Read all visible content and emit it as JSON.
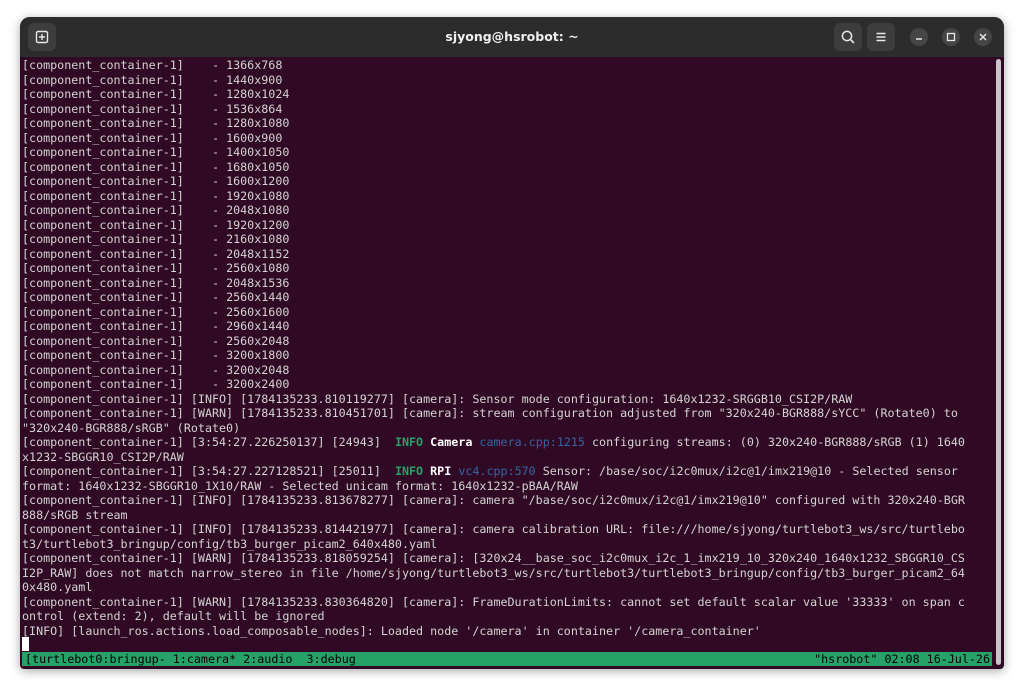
{
  "window": {
    "title": "sjyong@hsrobot: ~"
  },
  "icons": {
    "new_tab": "new-tab-icon",
    "search": "search-icon",
    "menu": "hamburger-menu-icon",
    "minimize": "minimize-icon",
    "maximize": "maximize-icon",
    "close": "close-icon"
  },
  "terminal": {
    "resolution_prefix": "[component_container-1]    - ",
    "resolutions": [
      "1366x768",
      "1440x900",
      "1280x1024",
      "1536x864",
      "1280x1080",
      "1600x900",
      "1400x1050",
      "1680x1050",
      "1600x1200",
      "1920x1080",
      "2048x1080",
      "1920x1200",
      "2160x1080",
      "2048x1152",
      "2560x1080",
      "2048x1536",
      "2560x1440",
      "2560x1600",
      "2960x1440",
      "2560x2048",
      "3200x1800",
      "3200x2048",
      "3200x2400"
    ],
    "log": {
      "l1": "[component_container-1] [INFO] [1784135233.810119277] [camera]: Sensor mode configuration: 1640x1232-SRGGB10_CSI2P/RAW",
      "l2": "[component_container-1] [WARN] [1784135233.810451701] [camera]: stream configuration adjusted from \"320x240-BGR888/sYCC\" (Rotate0) to",
      "l3": "\"320x240-BGR888/sRGB\" (Rotate0)",
      "l4_pre": "[component_container-1] [3:54:27.226250137] [24943]  ",
      "l4_level": "INFO",
      "l4_cat": "Camera",
      "l4_src": "camera.cpp:1215",
      "l4_msg": " configuring streams: (0) 320x240-BGR888/sRGB (1) 1640",
      "l5": "x1232-SBGGR10_CSI2P/RAW",
      "l6_pre": "[component_container-1] [3:54:27.227128521] [25011]  ",
      "l6_level": "INFO",
      "l6_cat": "RPI",
      "l6_src": "vc4.cpp:570",
      "l6_msg": " Sensor: /base/soc/i2c0mux/i2c@1/imx219@10 - Selected sensor",
      "l7": "format: 1640x1232-SBGGR10_1X10/RAW - Selected unicam format: 1640x1232-pBAA/RAW",
      "l8": "[component_container-1] [INFO] [1784135233.813678277] [camera]: camera \"/base/soc/i2c0mux/i2c@1/imx219@10\" configured with 320x240-BGR",
      "l9": "888/sRGB stream",
      "l10": "[component_container-1] [INFO] [1784135233.814421977] [camera]: camera calibration URL: file:///home/sjyong/turtlebot3_ws/src/turtlebo",
      "l11": "t3/turtlebot3_bringup/config/tb3_burger_picam2_640x480.yaml",
      "l12": "[component_container-1] [WARN] [1784135233.818059254] [camera]: [320x24__base_soc_i2c0mux_i2c_1_imx219_10_320x240_1640x1232_SBGGR10_CS",
      "l13": "I2P_RAW] does not match narrow_stereo in file /home/sjyong/turtlebot3_ws/src/turtlebot3/turtlebot3_bringup/config/tb3_burger_picam2_64",
      "l14": "0x480.yaml",
      "l15": "[component_container-1] [WARN] [1784135233.830364820] [camera]: FrameDurationLimits: cannot set default scalar value '33333' on span c",
      "l16": "ontrol (extend: 2), default will be ignored",
      "l17": "[INFO] [launch_ros.actions.load_composable_nodes]: Loaded node '/camera' in container '/camera_container'"
    }
  },
  "tmux": {
    "session": "[turtlebot0:bringup- ",
    "windows": [
      "1:camera*",
      "2:audio",
      "3:debug"
    ],
    "right": "\"hsrobot\" 02:08 16-Jul-26"
  }
}
